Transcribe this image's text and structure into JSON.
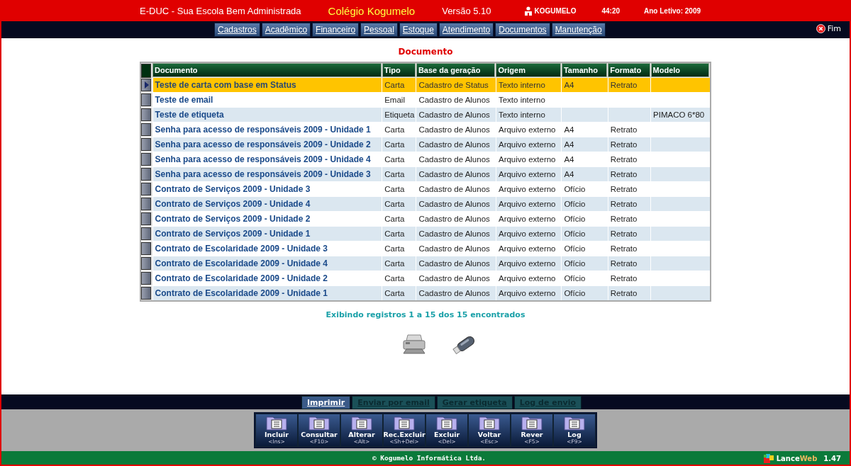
{
  "header": {
    "app_title": "E-DUC - Sua Escola Bem Administrada",
    "school": "Colégio Kogumelo",
    "version": "Versão 5.10",
    "user": "KOGUMELO",
    "timer": "44:20",
    "school_year": "Ano Letivo: 2009"
  },
  "menu": [
    "Cadastros",
    "Acadêmico",
    "Financeiro",
    "Pessoal",
    "Estoque",
    "Atendimento",
    "Documentos",
    "Manutenção"
  ],
  "exit_button": "Fim",
  "page_title": "Documento",
  "table": {
    "columns": [
      "Documento",
      "Tipo",
      "Base da geração",
      "Origem",
      "Tamanho",
      "Formato",
      "Modelo"
    ],
    "rows": [
      {
        "selected": true,
        "cells": [
          "Teste de carta com base em Status",
          "Carta",
          "Cadastro de Status",
          "Texto interno",
          "A4",
          "Retrato",
          ""
        ]
      },
      {
        "selected": false,
        "cells": [
          "Teste de email",
          "Email",
          "Cadastro de Alunos",
          "Texto interno",
          "",
          "",
          ""
        ]
      },
      {
        "selected": false,
        "cells": [
          "Teste de etiqueta",
          "Etiqueta",
          "Cadastro de Alunos",
          "Texto interno",
          "",
          "",
          "PIMACO 6*80"
        ]
      },
      {
        "selected": false,
        "cells": [
          "Senha para acesso de responsáveis 2009 - Unidade 1",
          "Carta",
          "Cadastro de Alunos",
          "Arquivo externo",
          "A4",
          "Retrato",
          ""
        ]
      },
      {
        "selected": false,
        "cells": [
          "Senha para acesso de responsáveis 2009 - Unidade 2",
          "Carta",
          "Cadastro de Alunos",
          "Arquivo externo",
          "A4",
          "Retrato",
          ""
        ]
      },
      {
        "selected": false,
        "cells": [
          "Senha para acesso de responsáveis 2009 - Unidade 4",
          "Carta",
          "Cadastro de Alunos",
          "Arquivo externo",
          "A4",
          "Retrato",
          ""
        ]
      },
      {
        "selected": false,
        "cells": [
          "Senha para acesso de responsáveis 2009 - Unidade 3",
          "Carta",
          "Cadastro de Alunos",
          "Arquivo externo",
          "A4",
          "Retrato",
          ""
        ]
      },
      {
        "selected": false,
        "cells": [
          "Contrato de Serviços 2009 - Unidade 3",
          "Carta",
          "Cadastro de Alunos",
          "Arquivo externo",
          "Ofício",
          "Retrato",
          ""
        ]
      },
      {
        "selected": false,
        "cells": [
          "Contrato de Serviços 2009 - Unidade 4",
          "Carta",
          "Cadastro de Alunos",
          "Arquivo externo",
          "Ofício",
          "Retrato",
          ""
        ]
      },
      {
        "selected": false,
        "cells": [
          "Contrato de Serviços 2009 - Unidade 2",
          "Carta",
          "Cadastro de Alunos",
          "Arquivo externo",
          "Ofício",
          "Retrato",
          ""
        ]
      },
      {
        "selected": false,
        "cells": [
          "Contrato de Serviços 2009 - Unidade 1",
          "Carta",
          "Cadastro de Alunos",
          "Arquivo externo",
          "Ofício",
          "Retrato",
          ""
        ]
      },
      {
        "selected": false,
        "cells": [
          "Contrato de Escolaridade 2009 - Unidade 3",
          "Carta",
          "Cadastro de Alunos",
          "Arquivo externo",
          "Ofício",
          "Retrato",
          ""
        ]
      },
      {
        "selected": false,
        "cells": [
          "Contrato de Escolaridade 2009 - Unidade 4",
          "Carta",
          "Cadastro de Alunos",
          "Arquivo externo",
          "Ofício",
          "Retrato",
          ""
        ]
      },
      {
        "selected": false,
        "cells": [
          "Contrato de Escolaridade 2009 - Unidade 2",
          "Carta",
          "Cadastro de Alunos",
          "Arquivo externo",
          "Ofício",
          "Retrato",
          ""
        ]
      },
      {
        "selected": false,
        "cells": [
          "Contrato de Escolaridade 2009 - Unidade 1",
          "Carta",
          "Cadastro de Alunos",
          "Arquivo externo",
          "Ofício",
          "Retrato",
          ""
        ]
      }
    ]
  },
  "record_count": "Exibindo registros 1 a 15 dos 15 encontrados",
  "action_tabs": [
    {
      "label": "Imprimir",
      "selected": true
    },
    {
      "label": "Enviar por email",
      "selected": false
    },
    {
      "label": "Gerar etiqueta",
      "selected": false
    },
    {
      "label": "Log de envio",
      "selected": false
    }
  ],
  "toolbar": [
    {
      "label": "Incluir",
      "shortcut": "<Ins>"
    },
    {
      "label": "Consultar",
      "shortcut": "<F10>"
    },
    {
      "label": "Alterar",
      "shortcut": "<Alt>"
    },
    {
      "label": "Rec.Excluir",
      "shortcut": "<Sh+Del>"
    },
    {
      "label": "Excluir",
      "shortcut": "<Del>"
    },
    {
      "label": "Voltar",
      "shortcut": "<Esc>"
    },
    {
      "label": "Rever",
      "shortcut": "<F5>"
    },
    {
      "label": "Log",
      "shortcut": "<F9>"
    }
  ],
  "footer": {
    "copyright": "© Kogumelo Informática Ltda.",
    "brand": "Lance",
    "brand_accent": "Web",
    "brand_version": "1.47"
  }
}
